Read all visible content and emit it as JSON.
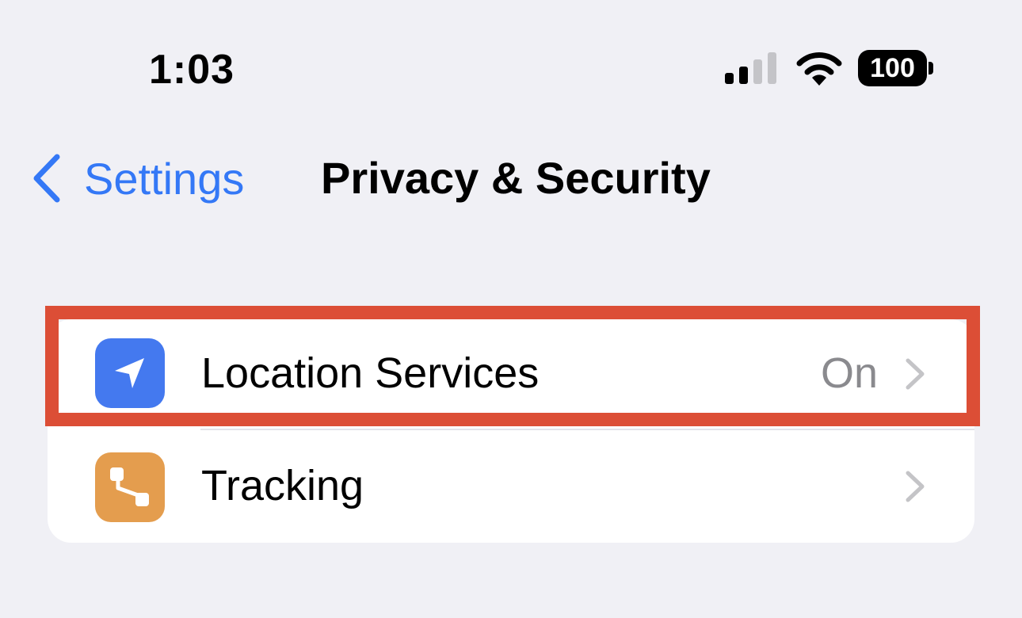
{
  "status_bar": {
    "time": "1:03",
    "battery_level": "100",
    "icons": [
      "cellular-signal-icon",
      "wifi-icon",
      "battery-icon"
    ]
  },
  "nav": {
    "back_label": "Settings",
    "title": "Privacy & Security"
  },
  "list": {
    "items": [
      {
        "label": "Location Services",
        "value": "On",
        "icon": "location-arrow-icon",
        "icon_color": "#4479ef",
        "highlighted": true
      },
      {
        "label": "Tracking",
        "value": "",
        "icon": "tracking-icon",
        "icon_color": "#e49d4e",
        "highlighted": false
      }
    ]
  },
  "colors": {
    "accent": "#3478f6",
    "background": "#f0f0f5",
    "highlight": "#dc4e36"
  }
}
